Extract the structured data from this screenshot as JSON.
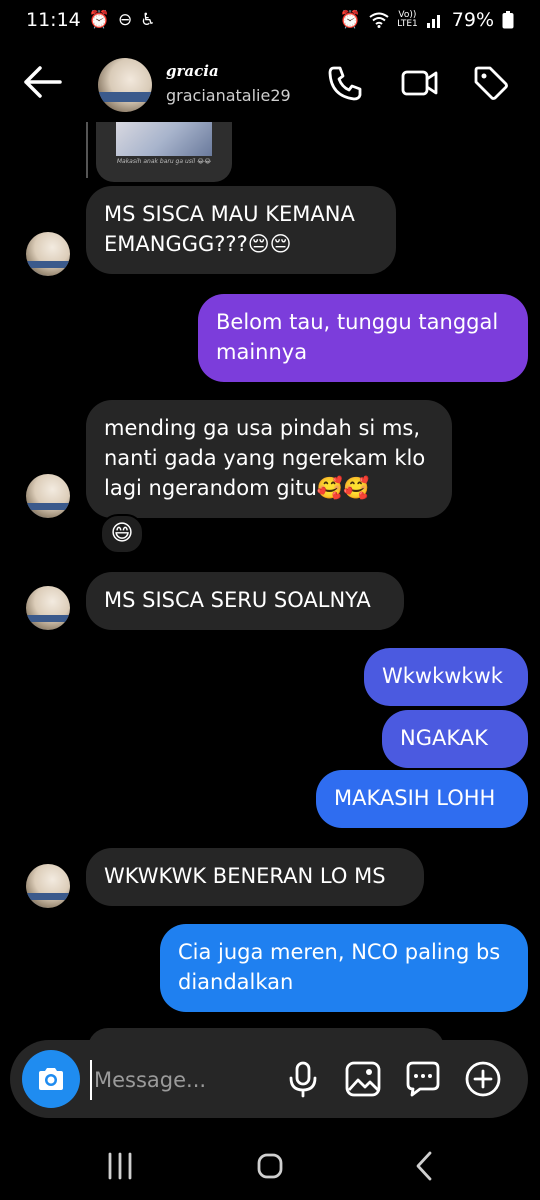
{
  "status_bar": {
    "time": "11:14",
    "left_icons": [
      "alarm-icon",
      "do-not-disturb-icon",
      "accessibility-icon"
    ],
    "volte_line1": "Vo))",
    "volte_line2": "LTE1",
    "battery": "79%"
  },
  "header": {
    "name": "gracia",
    "handle": "gracianatalie29"
  },
  "shared_post": {
    "caption": "Makasih anak baru ga usil 😂😂"
  },
  "messages": [
    {
      "side": "received",
      "lines": [
        "MS SISCA MAU KEMANA",
        "EMANGGG???😔😔"
      ]
    },
    {
      "side": "sent",
      "lines": [
        "Belom tau, tunggu tanggal",
        "mainnya"
      ]
    },
    {
      "side": "received",
      "lines": [
        "mending ga usa pindah si ms,",
        "nanti gada yang ngerekam klo",
        "lagi ngerandom gitu🥰🥰"
      ],
      "reaction": "😄"
    },
    {
      "side": "received",
      "lines": [
        "MS SISCA SERU SOALNYA"
      ]
    },
    {
      "side": "sent",
      "lines": [
        "Wkwkwkwk"
      ]
    },
    {
      "side": "sent",
      "lines": [
        "NGAKAK"
      ]
    },
    {
      "side": "sent",
      "lines": [
        "MAKASIH LOHH"
      ]
    },
    {
      "side": "received",
      "lines": [
        "WKWKWK BENERAN LO MS"
      ]
    },
    {
      "side": "sent",
      "lines": [
        "Cia juga meren, NCO paling bs",
        "diandalkan"
      ]
    }
  ],
  "composer": {
    "placeholder": "Message..."
  },
  "colors": {
    "background": "#000000",
    "received_bubble": "#262626",
    "sent_purple": "#7c3ddb",
    "sent_indigo": "#4b5ae0",
    "sent_blue": "#2f6df0",
    "sent_sky": "#1f80f0",
    "camera_button": "#1f8cf0"
  }
}
